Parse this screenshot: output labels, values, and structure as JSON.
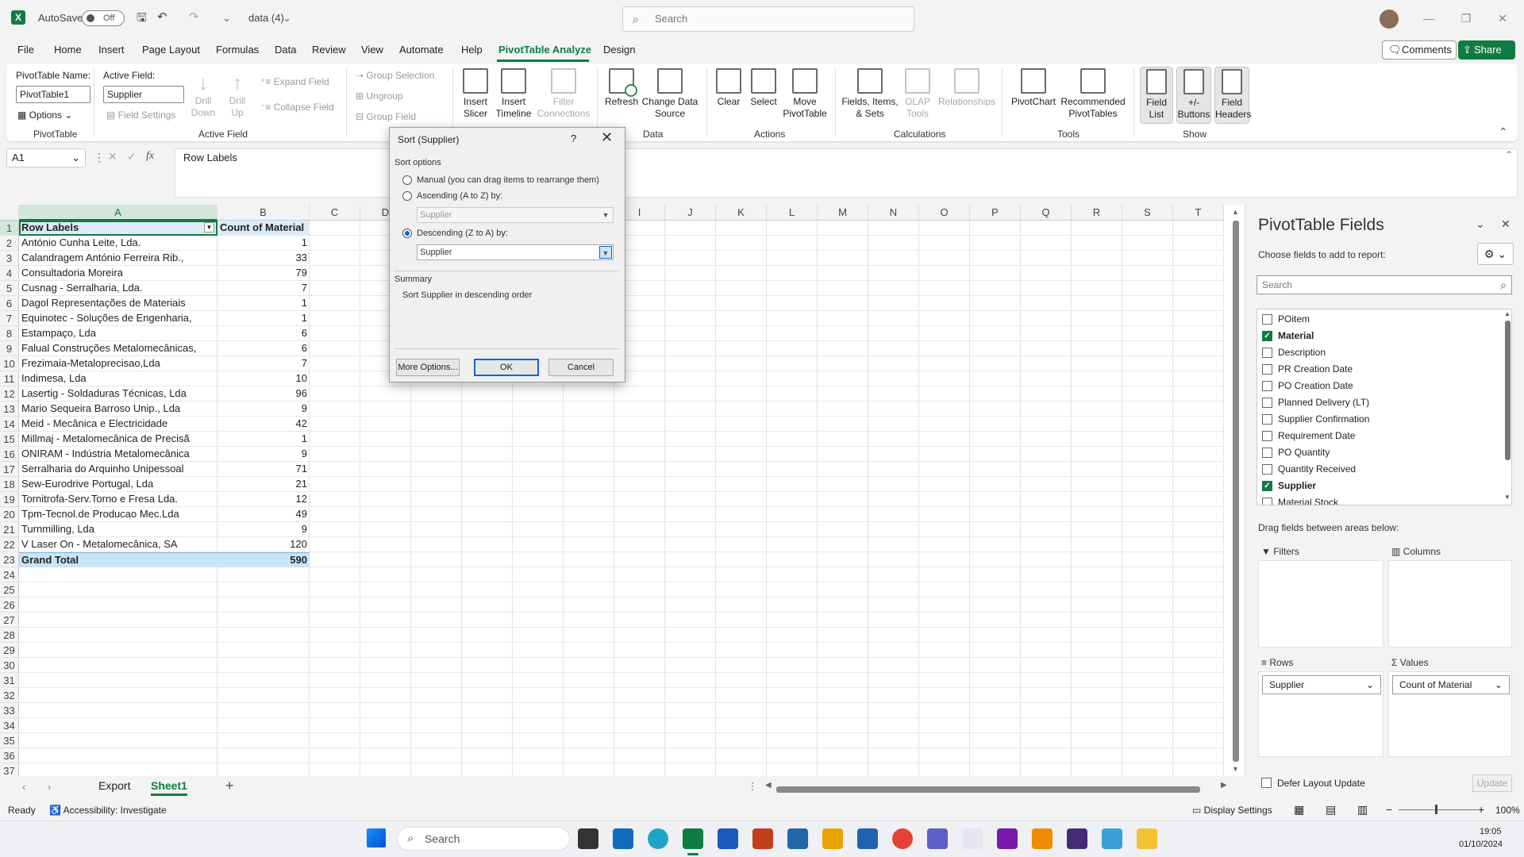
{
  "app": {
    "autosave_label": "AutoSave",
    "autosave_state": "Off",
    "filename": "data (4)",
    "search_placeholder": "Search"
  },
  "menu": {
    "items": [
      "File",
      "Home",
      "Insert",
      "Page Layout",
      "Formulas",
      "Data",
      "Review",
      "View",
      "Automate",
      "Help",
      "PivotTable Analyze",
      "Design"
    ],
    "active": "PivotTable Analyze",
    "comments_label": "Comments",
    "share_label": "Share"
  },
  "ribbon": {
    "pivot_name_label": "PivotTable Name:",
    "pivot_name_value": "PivotTable1",
    "options_label": "Options",
    "group_pivottable": "PivotTable",
    "active_field_label": "Active Field:",
    "active_field_value": "Supplier",
    "field_settings": "Field Settings",
    "drill_down": "Drill Down",
    "drill_up": "Drill Up",
    "expand_field": "Expand Field",
    "collapse_field": "Collapse Field",
    "group_active_field": "Active Field",
    "group_selection": "Group Selection",
    "ungroup": "Ungroup",
    "group_field": "Group Field",
    "group_group": "Group",
    "insert_slicer": "Insert Slicer",
    "insert_timeline": "Insert Timeline",
    "filter_connections": "Filter Connections",
    "group_filter": "Filter",
    "refresh": "Refresh",
    "change_data_source": "Change Data Source",
    "group_data": "Data",
    "clear": "Clear",
    "select": "Select",
    "move_pivottable": "Move PivotTable",
    "group_actions": "Actions",
    "fields_items_sets": "Fields, Items, & Sets",
    "olap_tools": "OLAP Tools",
    "relationships": "Relationships",
    "group_calculations": "Calculations",
    "pivotchart": "PivotChart",
    "recommended_pivottables": "Recommended PivotTables",
    "group_tools": "Tools",
    "field_list": "Field List",
    "buttons": "+/- Buttons",
    "field_headers": "Field Headers",
    "group_show": "Show"
  },
  "formula_bar": {
    "name_box": "A1",
    "content": "Row Labels"
  },
  "sheet": {
    "columns": [
      "A",
      "B",
      "C",
      "D",
      "E",
      "F",
      "G",
      "H",
      "I",
      "J",
      "K",
      "L",
      "M",
      "N",
      "O",
      "P",
      "Q",
      "R",
      "S",
      "T"
    ],
    "row_numbers": [
      "1",
      "2",
      "3",
      "4",
      "5",
      "6",
      "7",
      "8",
      "9",
      "10",
      "11",
      "12",
      "13",
      "14",
      "15",
      "16",
      "17",
      "18",
      "19",
      "20",
      "21",
      "22",
      "23",
      "24",
      "25",
      "26",
      "27",
      "28",
      "29",
      "30",
      "31",
      "32",
      "33",
      "34",
      "35",
      "36",
      "37"
    ],
    "header": {
      "a": "Row Labels",
      "b": "Count of Material"
    },
    "rows": [
      {
        "a": "António Cunha Leite, Lda.",
        "b": "1"
      },
      {
        "a": "Calandragem António Ferreira Rib.,",
        "b": "33"
      },
      {
        "a": "Consultadoria Moreira",
        "b": "79"
      },
      {
        "a": "Cusnag - Serralharia, Lda.",
        "b": "7"
      },
      {
        "a": "Dagol Representações de Materiais",
        "b": "1"
      },
      {
        "a": "Equinotec - Soluções de Engenharia,",
        "b": "1"
      },
      {
        "a": "Estampaço, Lda",
        "b": "6"
      },
      {
        "a": "Falual Construções Metalomecânicas,",
        "b": "6"
      },
      {
        "a": "Frezimaia-Metaloprecisao,Lda",
        "b": "7"
      },
      {
        "a": "Indimesa, Lda",
        "b": "10"
      },
      {
        "a": "Lasertig - Soldaduras Técnicas, Lda",
        "b": "96"
      },
      {
        "a": "Mario Sequeira Barroso Unip., Lda",
        "b": "9"
      },
      {
        "a": "Meid - Mecânica e Electricidade",
        "b": "42"
      },
      {
        "a": "Millmaj - Metalomecânica de Precisã",
        "b": "1"
      },
      {
        "a": "ONIRAM - Indústria Metalomecânica",
        "b": "9"
      },
      {
        "a": "Serralharia do Arquinho Unipessoal",
        "b": "71"
      },
      {
        "a": "Sew-Eurodrive Portugal, Lda",
        "b": "21"
      },
      {
        "a": "Tornitrofa-Serv.Torno e Fresa Lda.",
        "b": "12"
      },
      {
        "a": "Tpm-Tecnol.de Producao Mec.Lda",
        "b": "49"
      },
      {
        "a": "Turnmilling, Lda",
        "b": "9"
      },
      {
        "a": "V Laser On - Metalomecânica, SA",
        "b": "120"
      }
    ],
    "total": {
      "a": "Grand Total",
      "b": "590"
    },
    "tabs": [
      "Export",
      "Sheet1"
    ],
    "active_tab": "Sheet1"
  },
  "dialog": {
    "title": "Sort (Supplier)",
    "help": "?",
    "section_options": "Sort options",
    "manual": "Manual (you can drag items to rearrange them)",
    "ascending": "Ascending (A to Z) by:",
    "ascending_value": "Supplier",
    "descending": "Descending (Z to A) by:",
    "descending_value": "Supplier",
    "selected_option": "descending",
    "section_summary": "Summary",
    "summary_text": "Sort Supplier in descending order",
    "more_options": "More Options...",
    "ok": "OK",
    "cancel": "Cancel"
  },
  "pivot_panel": {
    "title": "PivotTable Fields",
    "subtitle": "Choose fields to add to report:",
    "search_placeholder": "Search",
    "fields": [
      {
        "name": "POitem",
        "checked": false
      },
      {
        "name": "Material",
        "checked": true
      },
      {
        "name": "Description",
        "checked": false
      },
      {
        "name": "PR Creation Date",
        "checked": false
      },
      {
        "name": "PO Creation Date",
        "checked": false
      },
      {
        "name": "Planned Delivery (LT)",
        "checked": false
      },
      {
        "name": "Supplier Confirmation",
        "checked": false
      },
      {
        "name": "Requirement Date",
        "checked": false
      },
      {
        "name": "PO Quantity",
        "checked": false
      },
      {
        "name": "Quantity Received",
        "checked": false
      },
      {
        "name": "Supplier",
        "checked": true
      },
      {
        "name": "Material Stock",
        "checked": false
      }
    ],
    "drag_hint": "Drag fields between areas below:",
    "filters_label": "Filters",
    "columns_label": "Columns",
    "rows_label": "Rows",
    "values_label": "Values",
    "rows_field": "Supplier",
    "values_field": "Count of Material",
    "defer_label": "Defer Layout Update",
    "update_label": "Update"
  },
  "status_bar": {
    "ready": "Ready",
    "accessibility": "Accessibility: Investigate",
    "display_settings": "Display Settings",
    "zoom": "100%"
  },
  "taskbar": {
    "search_placeholder": "Search",
    "time": "19:05",
    "date": "01/10/2024"
  },
  "colors": {
    "accent": "#107c41",
    "header_fill": "#ddebf7",
    "total_fill": "#c9e4f5",
    "dialog_focus": "#0a64d1"
  }
}
